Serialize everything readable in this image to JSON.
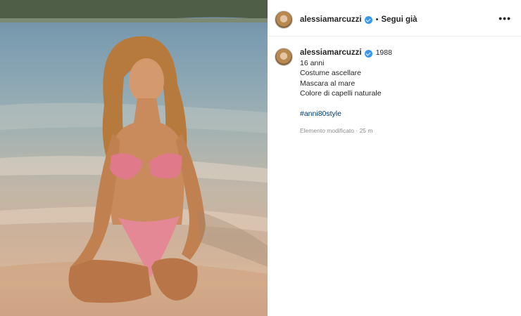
{
  "post": {
    "username": "alessiamarcuzzi",
    "follow_label": "Segui già",
    "separator": "•",
    "more_icon": "more-horizontal-icon",
    "more_glyph": "•••"
  },
  "caption": {
    "username": "alessiamarcuzzi",
    "first_line_text": "1988",
    "lines": [
      "16 anni",
      "Costume ascellare",
      "Mascara al mare",
      "Colore di capelli naturale"
    ],
    "hashtag": "#anni80style",
    "meta": "Elemento modificato · 25 m"
  },
  "colors": {
    "verified": "#3897f0",
    "hashtag": "#00376b",
    "text": "#262626",
    "muted": "#8e8e8e"
  }
}
